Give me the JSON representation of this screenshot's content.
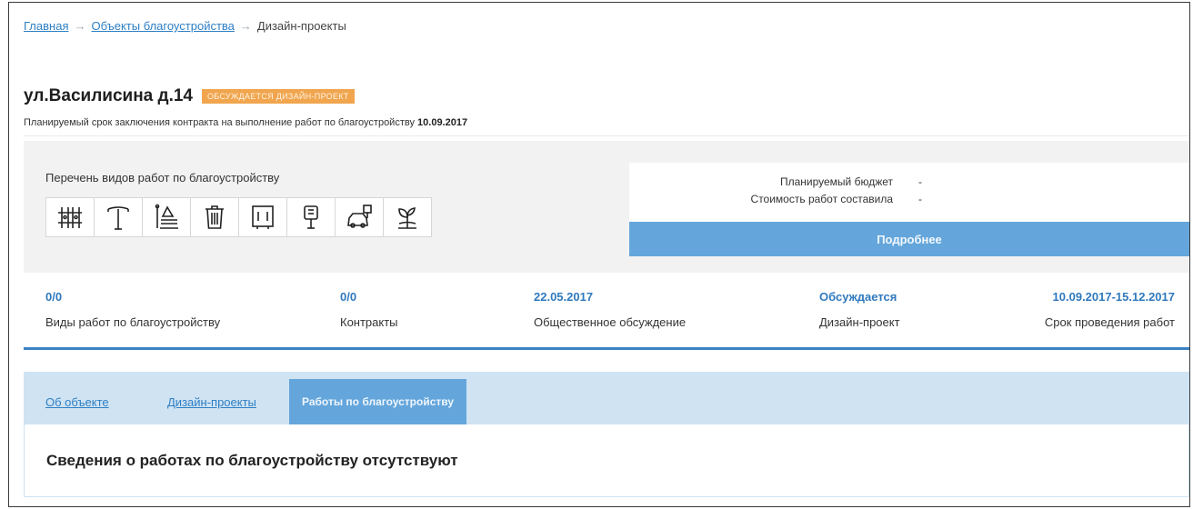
{
  "breadcrumb": {
    "home": "Главная",
    "section": "Объекты благоустройства",
    "current": "Дизайн-проекты",
    "separator": "→"
  },
  "object": {
    "title": "ул.Василисина д.14",
    "status": "ОБСУЖДАЕТСЯ ДИЗАЙН-ПРОЕКТ",
    "contract_text": "Планируемый срок заключения контракта на выполнение работ по благоустройству",
    "contract_date": "10.09.2017"
  },
  "works": {
    "title": "Перечень видов работ по благоустройству",
    "icons": [
      "fence-icon",
      "street-lamp-icon",
      "bench-icon",
      "trash-bin-icon",
      "board-icon",
      "lantern-icon",
      "parking-icon",
      "greenery-icon"
    ]
  },
  "budget": {
    "planned_label": "Планируемый бюджет",
    "planned_value": "-",
    "cost_label": "Стоимость работ составила",
    "cost_value": "-",
    "details_button": "Подробнее"
  },
  "stats": [
    {
      "value": "0/0",
      "caption": "Виды работ по благоустройству"
    },
    {
      "value": "0/0",
      "caption": "Контракты"
    },
    {
      "value": "22.05.2017",
      "caption": "Общественное обсуждение"
    },
    {
      "value": "Обсуждается",
      "caption": "Дизайн-проект"
    },
    {
      "value": "10.09.2017-15.12.2017",
      "caption": "Срок проведения работ"
    }
  ],
  "tabs": [
    {
      "label": "Об объекте"
    },
    {
      "label": "Дизайн-проекты"
    },
    {
      "label": "Работы по благоустройству"
    }
  ],
  "content": {
    "empty_message": "Сведения о работах по благоустройству отсутствуют"
  },
  "colors": {
    "accent": "#64a6db",
    "link": "#2e7fc4",
    "status_badge": "#f0a54e",
    "panel": "#f2f2f2",
    "tabs_bar": "#cfe3f3"
  }
}
